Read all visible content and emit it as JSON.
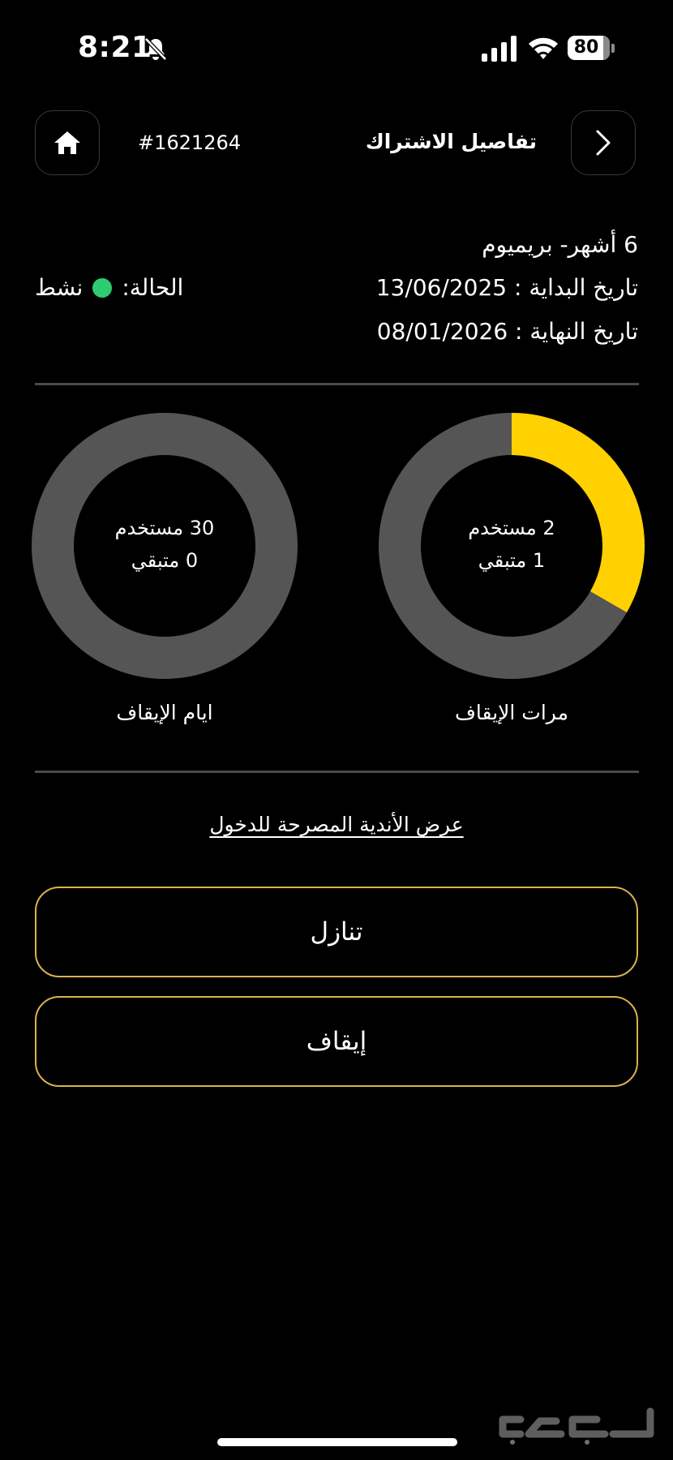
{
  "status_bar": {
    "time": "8:21",
    "battery": "80"
  },
  "header": {
    "title": "تفاصيل الاشتراك",
    "subscription_id": "#1621264"
  },
  "subscription": {
    "plan": "6 أشهر- بريميوم",
    "start_label": "تاريخ البداية :",
    "start_date": "13/06/2025",
    "end_label": "تاريخ النهاية :",
    "end_date": "08/01/2026",
    "status_label": "الحالة:",
    "status_value": "نشط",
    "status_color": "#2ecc71"
  },
  "chart_data": [
    {
      "type": "pie",
      "title": "مرات الإيقاف",
      "used_text": "2 مستخدم",
      "remaining_text": "1 متبقي",
      "used": 2,
      "remaining": 1,
      "fill_color": "#ffd100",
      "track_color": "#555555"
    },
    {
      "type": "pie",
      "title": "ايام الإيقاف",
      "used_text": "30 مستخدم",
      "remaining_text": "0 متبقي",
      "used": 30,
      "remaining": 0,
      "fill_color": "#ffd100",
      "track_color": "#555555"
    }
  ],
  "links": {
    "clubs": "عرض الأندية المصرحة للدخول"
  },
  "actions": {
    "cancel": "تنازل",
    "freeze": "إيقاف"
  },
  "watermark": "حراج"
}
